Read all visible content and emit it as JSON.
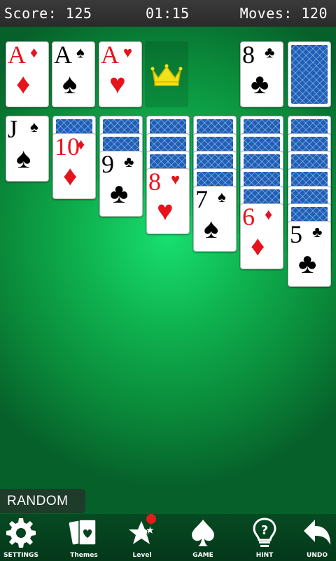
{
  "header": {
    "score_label": "Score: 125",
    "timer": "01:15",
    "moves_label": "Moves: 120"
  },
  "foundations": [
    {
      "rank": "A",
      "suit": "♦",
      "color": "red"
    },
    {
      "rank": "A",
      "suit": "♠",
      "color": "black"
    },
    {
      "rank": "A",
      "suit": "♥",
      "color": "red"
    },
    {
      "empty": true,
      "icon": "crown-icon"
    }
  ],
  "waste": {
    "rank": "8",
    "suit": "♣",
    "color": "black"
  },
  "stock": {
    "face_down": true
  },
  "tableau": [
    {
      "hidden": 0,
      "top": {
        "rank": "J",
        "suit": "♠",
        "color": "black"
      }
    },
    {
      "hidden": 1,
      "top": {
        "rank": "10",
        "suit": "♦",
        "color": "red"
      }
    },
    {
      "hidden": 2,
      "top": {
        "rank": "9",
        "suit": "♣",
        "color": "black"
      }
    },
    {
      "hidden": 3,
      "top": {
        "rank": "8",
        "suit": "♥",
        "color": "red"
      }
    },
    {
      "hidden": 4,
      "top": {
        "rank": "7",
        "suit": "♠",
        "color": "black"
      }
    },
    {
      "hidden": 5,
      "top": {
        "rank": "6",
        "suit": "♦",
        "color": "red"
      }
    },
    {
      "hidden": 6,
      "top": {
        "rank": "5",
        "suit": "♣",
        "color": "black"
      }
    }
  ],
  "mode_label": "RANDOM",
  "toolbar": {
    "settings": "SETTINGS",
    "themes": "Themes",
    "level": "Level",
    "game": "GAME",
    "hint": "HINT",
    "undo": "UNDO"
  },
  "colors": {
    "felt": "#0fb450",
    "top_bar": "#2e2e2e",
    "toolbar": "#05421e",
    "card_back": "#1e5fb8",
    "red_suit": "#e5131b",
    "badge": "#e51b1b"
  }
}
